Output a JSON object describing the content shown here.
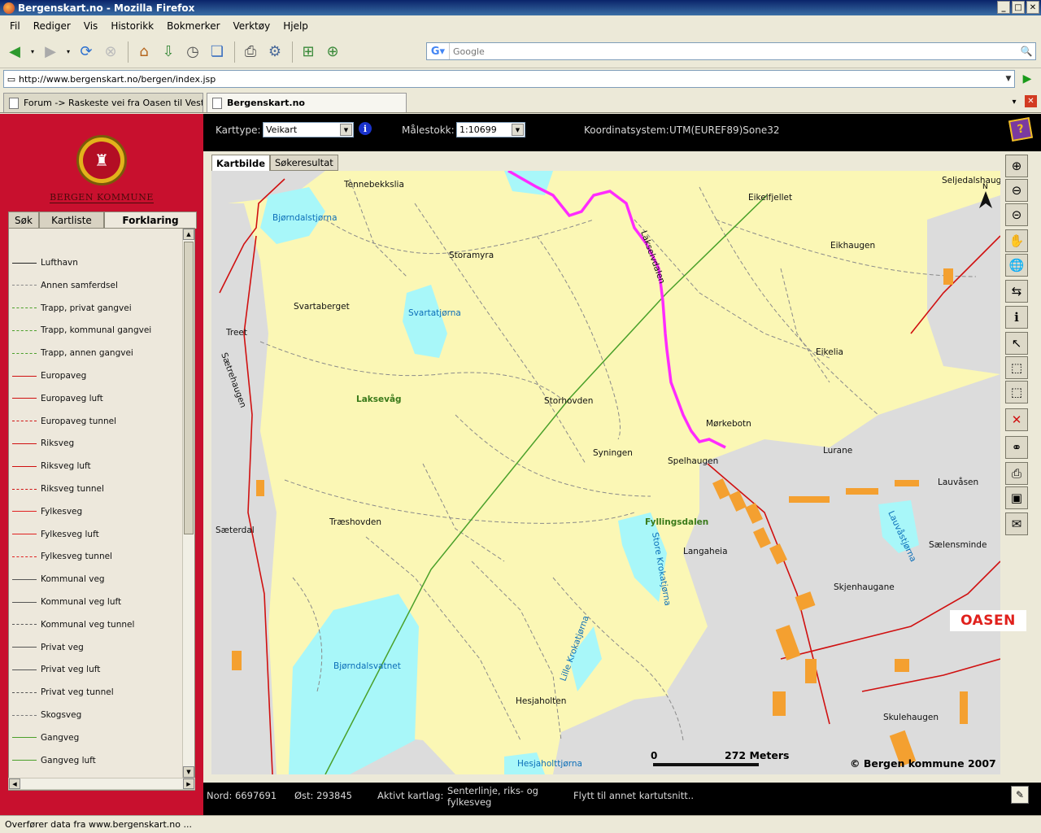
{
  "browser": {
    "title": "Bergenskart.no - Mozilla Firefox",
    "menu": [
      "Fil",
      "Rediger",
      "Vis",
      "Historikk",
      "Bokmerker",
      "Verktøy",
      "Hjelp"
    ],
    "search_placeholder": "Google",
    "url": "http://www.bergenskart.no/bergen/index.jsp",
    "tabs": [
      {
        "label": "Forum -> Raskeste vei fra Oasen til Vestk...",
        "active": false
      },
      {
        "label": "Bergenskart.no",
        "active": true
      }
    ],
    "status": "Overfører data fra www.bergenskart.no ..."
  },
  "sidebar": {
    "org": "BERGEN KOMMUNE",
    "tabs": [
      "Søk",
      "Kartliste",
      "Forklaring"
    ],
    "active_tab": "Forklaring",
    "legend": [
      {
        "label": "Lufthavn",
        "color": "#222222",
        "style": "solid"
      },
      {
        "label": "Annen samferdsel",
        "color": "#888888",
        "style": "dashed"
      },
      {
        "label": "Trapp, privat gangvei",
        "color": "#4aa02a",
        "style": "dashed"
      },
      {
        "label": "Trapp, kommunal gangvei",
        "color": "#4aa02a",
        "style": "dashed"
      },
      {
        "label": "Trapp, annen gangvei",
        "color": "#4aa02a",
        "style": "dashed"
      },
      {
        "label": "Europaveg",
        "color": "#d01010",
        "style": "solid"
      },
      {
        "label": "Europaveg luft",
        "color": "#d01010",
        "style": "solid"
      },
      {
        "label": "Europaveg tunnel",
        "color": "#d01010",
        "style": "dashed"
      },
      {
        "label": "Riksveg",
        "color": "#d01010",
        "style": "solid"
      },
      {
        "label": "Riksveg luft",
        "color": "#d01010",
        "style": "solid"
      },
      {
        "label": "Riksveg tunnel",
        "color": "#d01010",
        "style": "dashed"
      },
      {
        "label": "Fylkesveg",
        "color": "#e02020",
        "style": "solid"
      },
      {
        "label": "Fylkesveg luft",
        "color": "#e02020",
        "style": "solid"
      },
      {
        "label": "Fylkesveg tunnel",
        "color": "#e02020",
        "style": "dashed"
      },
      {
        "label": "Kommunal veg",
        "color": "#555555",
        "style": "solid"
      },
      {
        "label": "Kommunal veg luft",
        "color": "#555555",
        "style": "solid"
      },
      {
        "label": "Kommunal veg tunnel",
        "color": "#555555",
        "style": "dashed"
      },
      {
        "label": "Privat veg",
        "color": "#555555",
        "style": "solid"
      },
      {
        "label": "Privat veg luft",
        "color": "#555555",
        "style": "solid"
      },
      {
        "label": "Privat veg tunnel",
        "color": "#555555",
        "style": "dashed"
      },
      {
        "label": "Skogsveg",
        "color": "#777777",
        "style": "dashed"
      },
      {
        "label": "Gangveg",
        "color": "#4aa02a",
        "style": "solid"
      },
      {
        "label": "Gangveg luft",
        "color": "#4aa02a",
        "style": "solid"
      }
    ]
  },
  "topbar": {
    "karttype_label": "Karttype:",
    "karttype_value": "Veikart",
    "malestokk_label": "Målestokk:",
    "malestokk_value": "1:10699",
    "koord_label": "Koordinatsystem:",
    "koord_value": "UTM(EUREF89)Sone32"
  },
  "map": {
    "tabs": [
      "Kartbilde",
      "Søkeresultat"
    ],
    "active_tab": "Kartbilde",
    "scale_zero": "0",
    "scale_label": "272 Meters",
    "copyright": "© Bergen kommune 2007",
    "north_label": "N",
    "places": [
      "Tennebekkslia",
      "Bjørndalstjørna",
      "Storamyra",
      "Svartaberget",
      "Svartatjørna",
      "Treet",
      "Sætrehaugen",
      "Laksevåg",
      "Storhovden",
      "Lakselvdalen",
      "Mørkebotn",
      "Syningen",
      "Spelhaugen",
      "Eikelfjellet",
      "Eikhaugen",
      "Eikelia",
      "Lurane",
      "Seljedalshauge",
      "Lauvåsen",
      "Lauvåstjørna",
      "Sælensminde",
      "Skjenhaugane",
      "Skulehaugen",
      "Sæterdal",
      "Træshovden",
      "Fyllingsdalen",
      "Store Krokatjørna",
      "Langaheia",
      "Lille Krokatjørna",
      "Bjørndalsvatnet",
      "Hesjaholten",
      "Hesjaholttjørna"
    ],
    "callout": "OASEN"
  },
  "status": {
    "nord": "Nord: 6697691",
    "ost": "Øst: 293845",
    "aktivt_label": "Aktivt kartlag:",
    "aktivt_value1": "Senterlinje, riks- og",
    "aktivt_value2": "fylkesveg",
    "flytt": "Flytt til annet kartutsnitt.."
  }
}
